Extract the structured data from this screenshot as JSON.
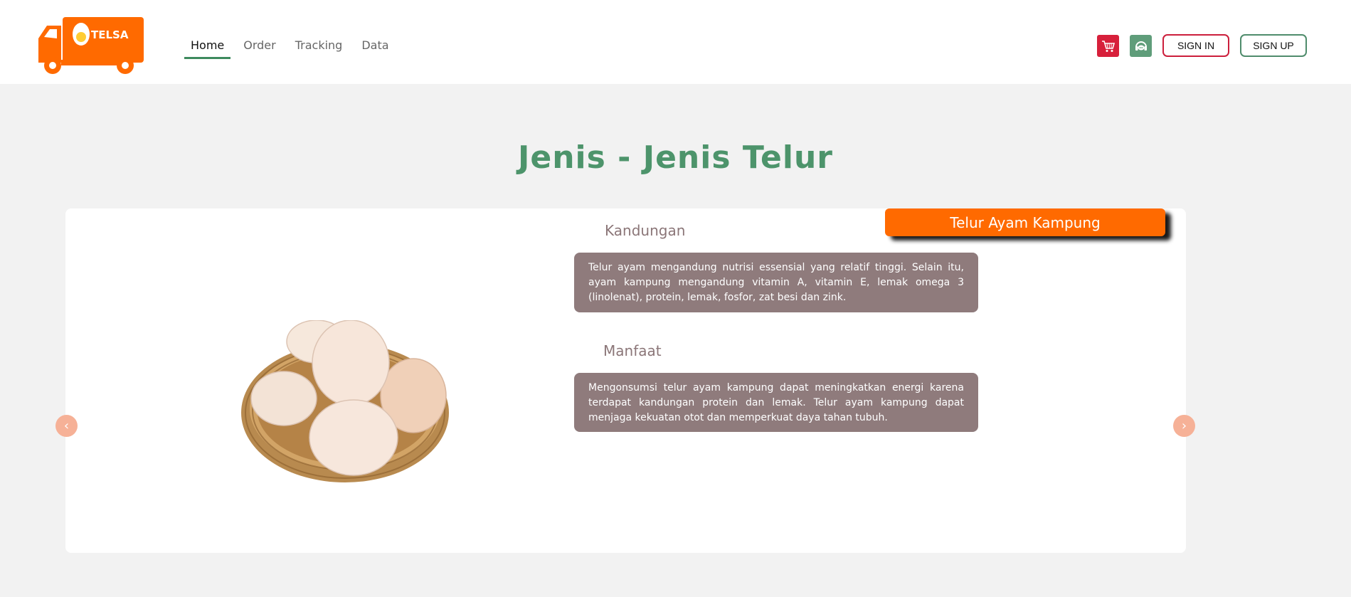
{
  "brand": {
    "logo_text": "TELSA",
    "accent": "#ff6a00"
  },
  "nav": {
    "items": [
      {
        "label": "Home",
        "active": true
      },
      {
        "label": "Order",
        "active": false
      },
      {
        "label": "Tracking",
        "active": false
      },
      {
        "label": "Data",
        "active": false
      }
    ]
  },
  "header_actions": {
    "cart_icon": "cart-icon",
    "support_icon": "support-icon",
    "signin_label": "SIGN IN",
    "signup_label": "SIGN UP"
  },
  "section": {
    "title": "Jenis - Jenis Telur"
  },
  "product": {
    "name": "Telur Ayam Kampung",
    "kandungan_label": "Kandungan",
    "kandungan_text": "Telur ayam mengandung nutrisi essensial yang relatif tinggi. Selain itu, ayam kampung mengandung vitamin A, vitamin E, lemak omega 3 (linolenat), protein, lemak, fosfor, zat besi dan zink.",
    "manfaat_label": "Manfaat",
    "manfaat_text": "Mengonsumsi telur ayam kampung dapat meningkatkan energi karena terdapat kandungan protein dan lemak. Telur ayam kampung dapat menjaga kekuatan otot dan memperkuat daya tahan tubuh."
  },
  "carousel": {
    "prev": "‹",
    "next": "›"
  },
  "colors": {
    "title_green": "#4d946b",
    "info_box": "#8f7b7c",
    "signin_border": "#cc1f3c",
    "signup_border": "#4f8c6c",
    "arrow": "#f6b197"
  }
}
